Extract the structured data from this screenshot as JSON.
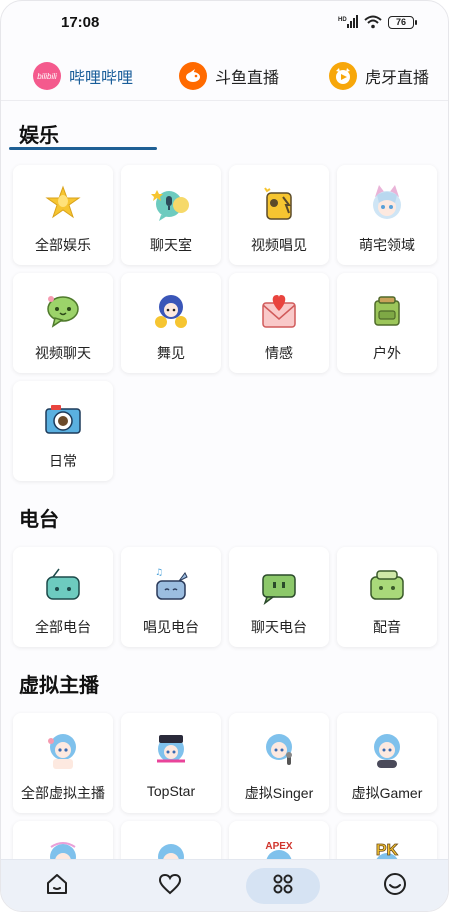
{
  "status_bar": {
    "time": "17:08",
    "network": "HD",
    "battery": "76"
  },
  "tabs": [
    {
      "label": "哔哩哔哩",
      "logo_text": "bilibili",
      "logo_color": "#f45a8d",
      "active": true
    },
    {
      "label": "斗鱼直播",
      "logo_color": "#ff6a00",
      "active": false
    },
    {
      "label": "虎牙直播",
      "logo_color": "#f7a70a",
      "active": false
    }
  ],
  "sections": [
    {
      "title": "娱乐",
      "items": [
        {
          "label": "全部娱乐",
          "icon": "star-microphone-icon"
        },
        {
          "label": "聊天室",
          "icon": "chat-room-icon"
        },
        {
          "label": "视频唱见",
          "icon": "music-tag-icon"
        },
        {
          "label": "萌宅领域",
          "icon": "cat-girl-icon"
        },
        {
          "label": "视频聊天",
          "icon": "video-chat-bubble-icon"
        },
        {
          "label": "舞见",
          "icon": "dancer-icon"
        },
        {
          "label": "情感",
          "icon": "love-letter-icon"
        },
        {
          "label": "户外",
          "icon": "backpack-icon"
        },
        {
          "label": "日常",
          "icon": "camera-icon"
        }
      ]
    },
    {
      "title": "电台",
      "items": [
        {
          "label": "全部电台",
          "icon": "radio-icon"
        },
        {
          "label": "唱见电台",
          "icon": "singing-radio-icon"
        },
        {
          "label": "聊天电台",
          "icon": "chat-tv-icon"
        },
        {
          "label": "配音",
          "icon": "dubbing-icon"
        }
      ]
    },
    {
      "title": "虚拟主播",
      "items": [
        {
          "label": "全部虚拟主播",
          "icon": "vtuber-all-icon"
        },
        {
          "label": "TopStar",
          "icon": "vtuber-topstar-icon"
        },
        {
          "label": "虚拟Singer",
          "icon": "vtuber-singer-icon"
        },
        {
          "label": "虚拟Gamer",
          "icon": "vtuber-gamer-icon"
        },
        {
          "label": "",
          "icon": "vtuber-icon"
        },
        {
          "label": "",
          "icon": "vtuber-icon"
        },
        {
          "label": "",
          "icon": "vtuber-apex-icon",
          "badge": "APEX"
        },
        {
          "label": "",
          "icon": "vtuber-pk-icon",
          "badge": "PK"
        }
      ]
    }
  ],
  "bottom_nav": [
    {
      "name": "home",
      "icon": "home-icon",
      "active": false
    },
    {
      "name": "favorites",
      "icon": "heart-icon",
      "active": false
    },
    {
      "name": "categories",
      "icon": "grid-icon",
      "active": true
    },
    {
      "name": "profile",
      "icon": "smile-icon",
      "active": false
    }
  ]
}
